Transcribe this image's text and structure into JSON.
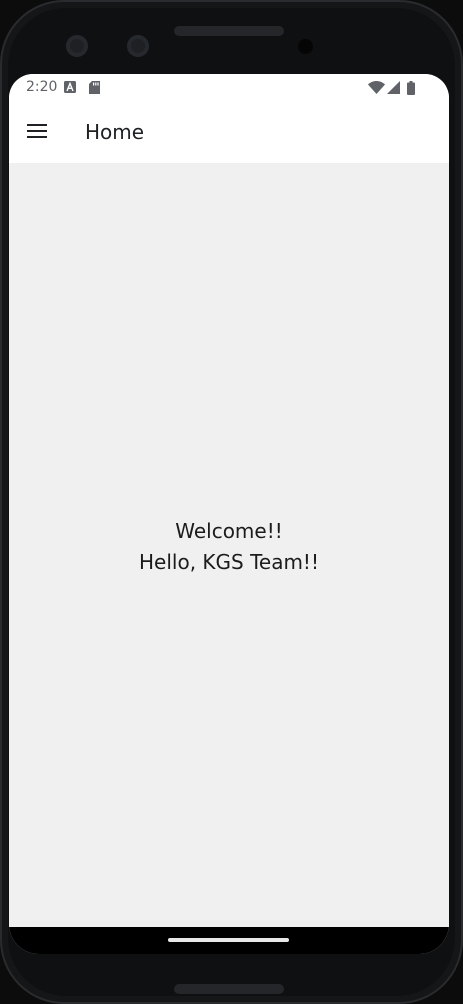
{
  "status_bar": {
    "time": "2:20",
    "icons": [
      "a-notification-icon",
      "sd-card-icon",
      "wifi-icon",
      "signal-icon",
      "battery-icon"
    ]
  },
  "app_bar": {
    "title": "Home",
    "menu_icon": "hamburger-menu-icon"
  },
  "content": {
    "line1": "Welcome!!",
    "line2": "Hello, KGS Team!!"
  },
  "colors": {
    "app_bar_bg": "#ffffff",
    "content_bg": "#f0f0f0",
    "text": "#1c1c1c",
    "nav_bar_bg": "#000000"
  }
}
